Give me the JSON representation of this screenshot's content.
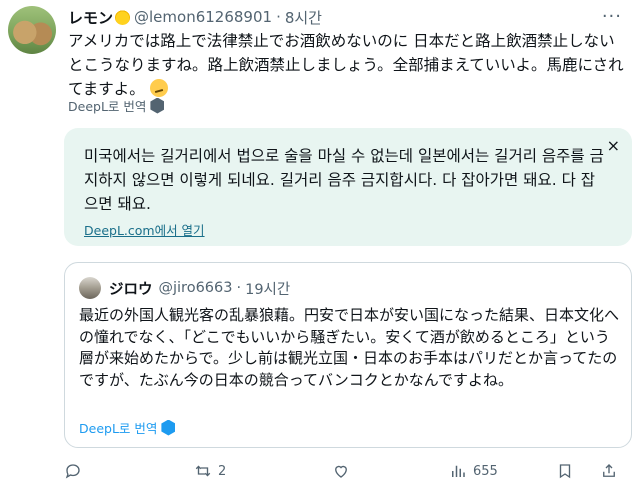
{
  "author": {
    "name": "レモン",
    "handle": "@lemon61268901",
    "separator": "·",
    "time": "8시간"
  },
  "tweet": {
    "text": "アメリカでは路上で法律禁止でお酒飲めないのに 日本だと路上飲酒禁止しないとこうなりますね。路上飲酒禁止しましょう。全部捕まえていいよ。馬鹿にされてますよ。"
  },
  "translate_label": "DeepL로 번역",
  "translation": {
    "text": "미국에서는 길거리에서 법으로 술을 마실 수 없는데 일본에서는 길거리 음주를 금지하지 않으면 이렇게 되네요. 길거리 음주 금지합시다. 다 잡아가면 돼요. 다 잡으면 돼요.",
    "open_label": "DeepL.com에서 열기",
    "close_symbol": "×"
  },
  "quote": {
    "name": "ジロウ",
    "handle": "@jiro6663",
    "separator": "·",
    "time": "19시간",
    "text": "最近の外国人観光客の乱暴狼藉。円安で日本が安い国になった結果、日本文化への憧れでなく、「どこでもいいから騒ぎたい。安くて酒が飲めるところ」という層が来始めたからで。少し前は観光立国・日本のお手本はパリだとか言ってたのですが、たぶん今の日本の競合ってバンコクとかなんですよね。",
    "translate_label": "DeepL로 번역"
  },
  "actions": {
    "replies": "",
    "retweets": "2",
    "likes": "",
    "views": "655"
  },
  "icons": [
    "more-icon",
    "deepl-icon",
    "close-icon",
    "reply-icon",
    "retweet-icon",
    "like-icon",
    "views-icon",
    "bookmark-icon",
    "share-icon"
  ],
  "colors": {
    "accent": "#1d9bf0",
    "translation_bg": "#e8f5f1",
    "muted": "#536471"
  }
}
